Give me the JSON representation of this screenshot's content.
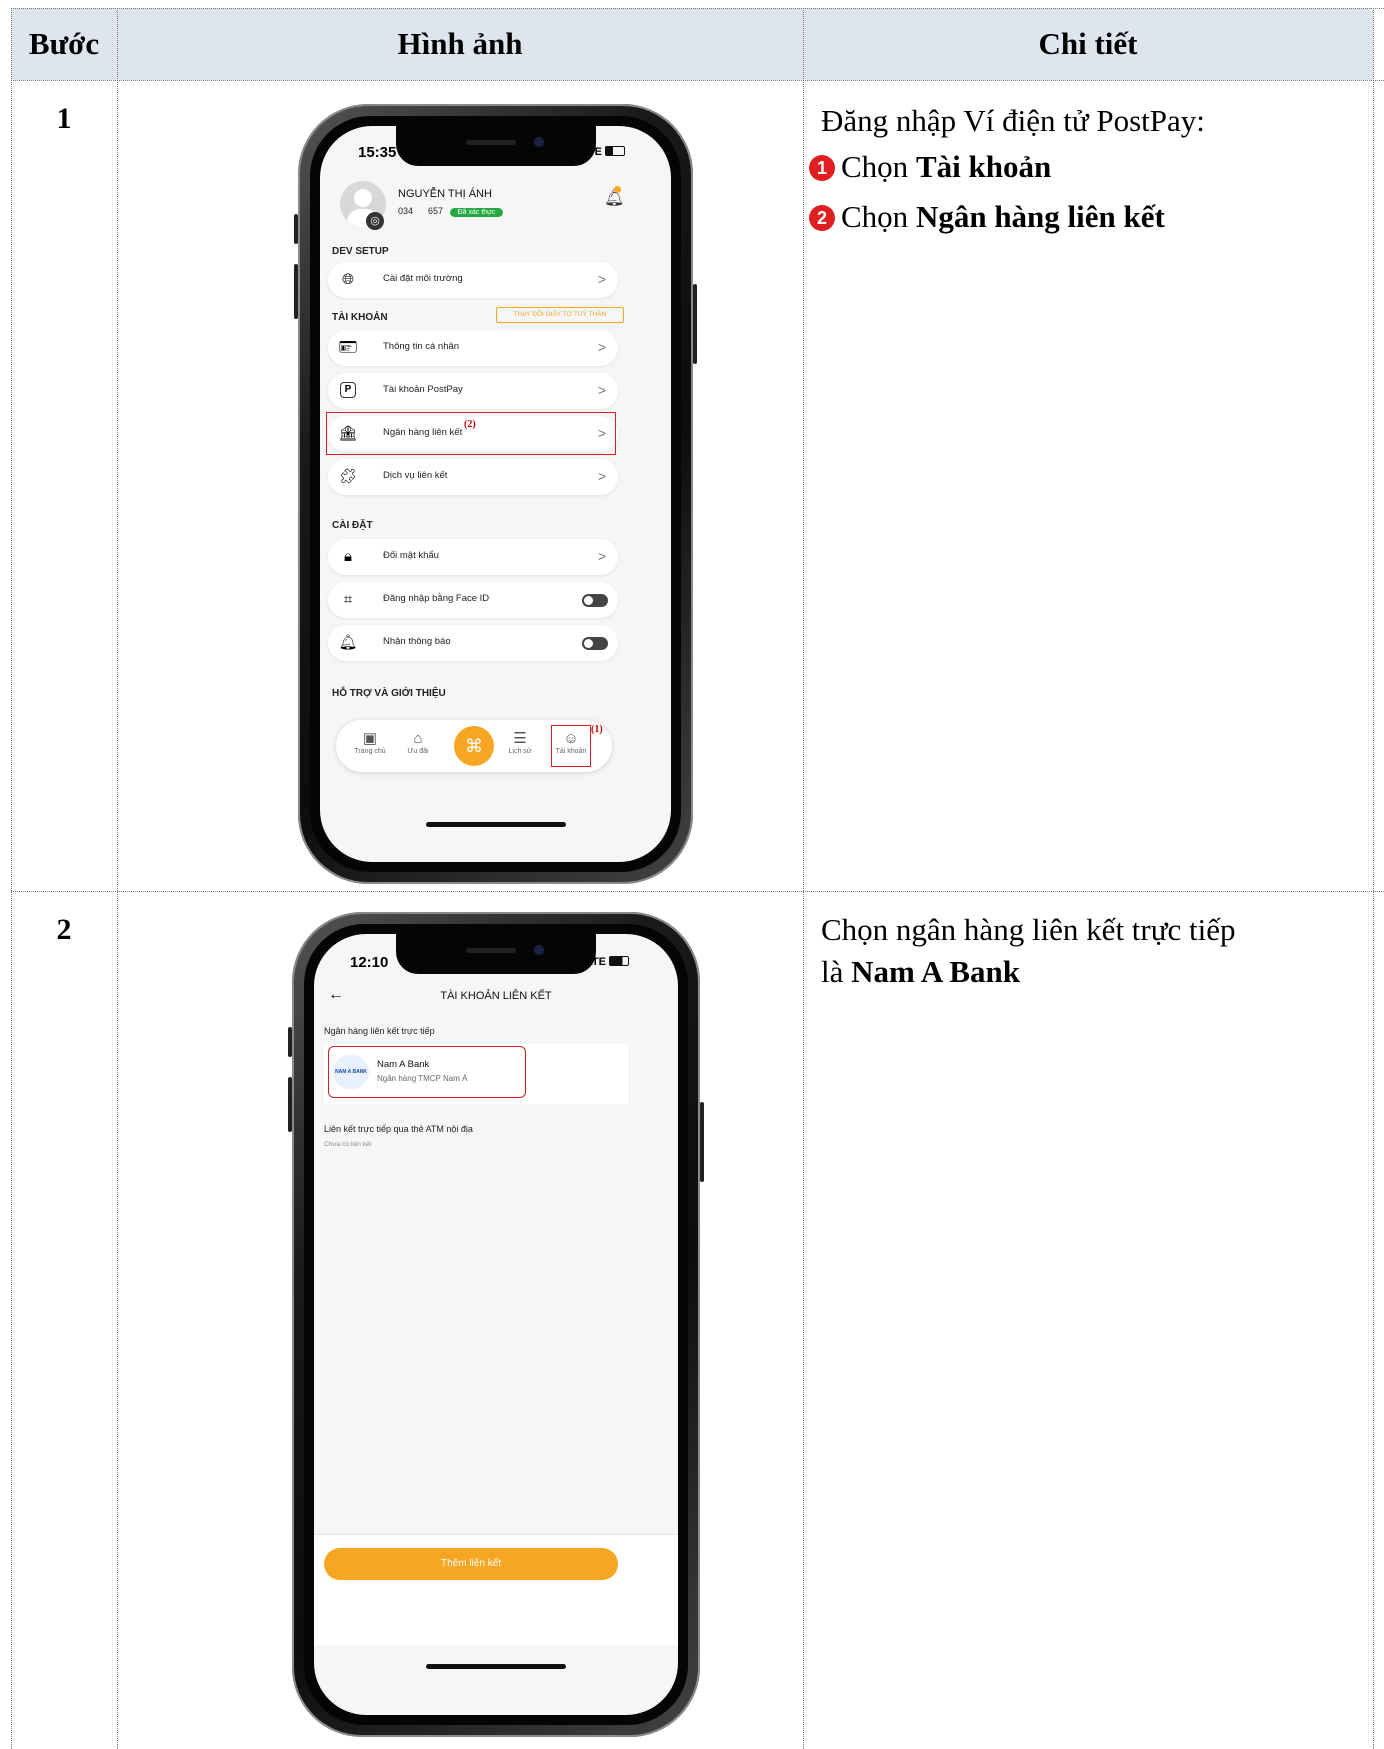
{
  "table": {
    "headers": {
      "step": "Bước",
      "image": "Hình ảnh",
      "detail": "Chi tiết"
    },
    "rows": [
      {
        "step": "1",
        "detail": {
          "intro": "Đăng nhập Ví điện tử PostPay:",
          "items": [
            {
              "badge": "1",
              "prefix": "Chọn",
              "bold": "Tài khoản"
            },
            {
              "badge": "2",
              "prefix": "Chọn",
              "bold": "Ngân hàng liên kết"
            }
          ]
        }
      },
      {
        "step": "2",
        "detail": {
          "line1": "Chọn ngân hàng liên kết trực tiếp",
          "line2_prefix": "là",
          "line2_bold": "Nam A Bank"
        }
      }
    ]
  },
  "phone1": {
    "time": "15:35",
    "network": "LTE",
    "user": {
      "name": "NGUYỄN THỊ ÁNH",
      "phone_start": "034",
      "phone_end": "657",
      "verified": "Đã xác thực"
    },
    "sections": {
      "dev": "DEV SETUP",
      "account": "TÀI KHOẢN",
      "settings": "CÀI ĐẶT",
      "support": "HỖ TRỢ VÀ GIỚI THIỆU"
    },
    "change_id_button": "THAY ĐỔI GIẤY TỜ TUỲ THÂN",
    "rows": {
      "env": "Cài đặt môi trường",
      "personal": "Thông tin cá nhân",
      "postpay": "Tài khoản PostPay",
      "bank": "Ngân hàng liên kết",
      "service": "Dịch vụ liên kết",
      "password": "Đổi mật khẩu",
      "faceid": "Đăng nhập bằng Face ID",
      "notify": "Nhận thông báo"
    },
    "annotations": {
      "bank": "(2)",
      "account_tab": "(1)"
    },
    "tabs": {
      "home": "Trang chủ",
      "offers": "Ưu đãi",
      "history": "Lịch sử",
      "account": "Tài khoản"
    }
  },
  "phone2": {
    "time": "12:10",
    "network": "LTE",
    "title": "TÀI KHOẢN LIÊN KẾT",
    "direct_section": "Ngân hàng liên kết trực tiếp",
    "bank_logo": "NAM A BANK",
    "bank_name": "Nam A Bank",
    "bank_fullname": "Ngân hàng TMCP Nam Á",
    "atm_section": "Liên kết trực tiếp qua thẻ ATM nội địa",
    "atm_empty": "Chưa có liên kết",
    "add_button": "Thêm liên kết"
  }
}
